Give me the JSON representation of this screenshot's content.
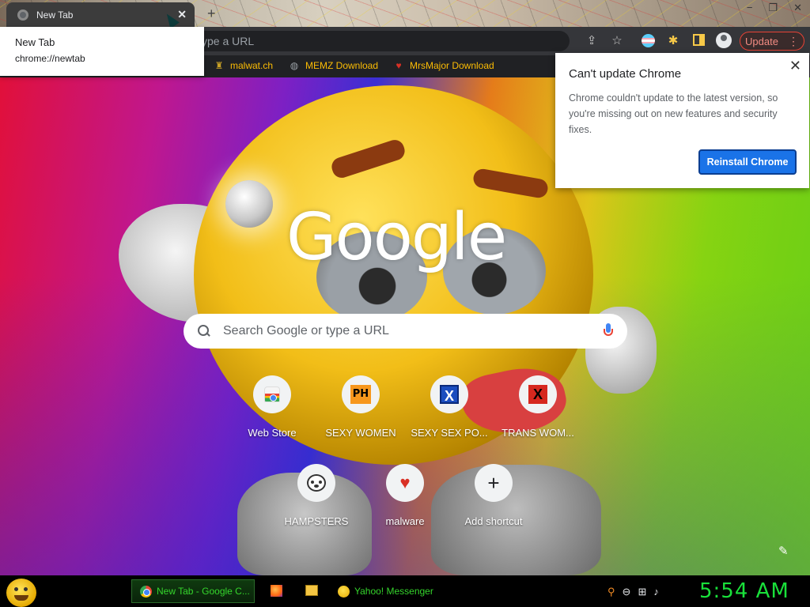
{
  "window": {
    "tab_title": "New Tab",
    "new_tab_icon": "plus-icon",
    "controls": [
      "−",
      "❐",
      "✕"
    ]
  },
  "tooltip": {
    "title": "New Tab",
    "url": "chrome://newtab"
  },
  "toolbar": {
    "omnibox_text": "ype a URL",
    "update_label": "Update",
    "update_color": "#e94235"
  },
  "bookmarks": [
    {
      "label": "malwat.ch",
      "icon": "chess-rook-icon"
    },
    {
      "label": "MEMZ Download",
      "icon": "globe-icon"
    },
    {
      "label": "MrsMajor Download",
      "icon": "heart-icon"
    }
  ],
  "update_popup": {
    "heading": "Can't update Chrome",
    "body": "Chrome couldn't update to the latest version, so you're missing out on new features and security fixes.",
    "button": "Reinstall Chrome",
    "button_color": "#1a73e8"
  },
  "new_tab_page": {
    "logo_text": "Google",
    "search_placeholder": "Search Google or type a URL",
    "shortcuts": [
      {
        "label": "Web Store",
        "icon": "chrome-web-store-icon"
      },
      {
        "label": "SEXY WOMEN",
        "icon": "ph-logo-icon"
      },
      {
        "label": "SEXY SEX PO...",
        "icon": "x-blue-icon"
      },
      {
        "label": "TRANS WOM...",
        "icon": "x-red-icon"
      },
      {
        "label": "HAMPSTERS",
        "icon": "hamster-icon"
      },
      {
        "label": "malware",
        "icon": "heart-icon"
      },
      {
        "label": "Add shortcut",
        "icon": "plus-icon"
      }
    ]
  },
  "taskbar": {
    "tasks": [
      {
        "label": "New Tab - Google C...",
        "icon": "chrome-icon",
        "active": true
      },
      {
        "label": "Yahoo! Messenger",
        "icon": "yahoo-smiley-icon",
        "active": false
      }
    ],
    "clock": "5:54 AM",
    "clock_color": "#19e03a"
  }
}
